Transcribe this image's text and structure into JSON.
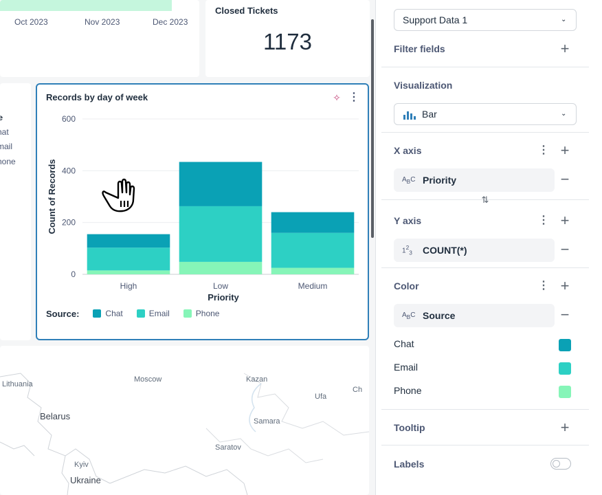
{
  "timeline": {
    "ticks": [
      "Oct 2023",
      "Nov 2023",
      "Dec 2023"
    ]
  },
  "closed": {
    "title": "Closed Tickets",
    "value": "1173"
  },
  "source_card": {
    "header": "rce",
    "items": [
      "hat",
      "mail",
      "hone"
    ]
  },
  "chart": {
    "menu_icon": "kebab-icon",
    "ai_icon": "sparkle-icon"
  },
  "chart_data": {
    "type": "bar",
    "stacked": true,
    "title": "Records by day of week",
    "xlabel": "Priority",
    "ylabel": "Count of Records",
    "categories": [
      "High",
      "Low",
      "Medium"
    ],
    "series": [
      {
        "name": "Chat",
        "values": [
          52,
          171,
          80
        ],
        "color": "#0aa1b5"
      },
      {
        "name": "Email",
        "values": [
          88,
          215,
          135
        ],
        "color": "#2dd0c4"
      },
      {
        "name": "Phone",
        "values": [
          15,
          48,
          25
        ],
        "color": "#86f5b8"
      }
    ],
    "ylim": [
      0,
      600
    ],
    "yticks": [
      0,
      200,
      400,
      600
    ],
    "legend_title": "Source:",
    "legend_position": "bottom-left",
    "grid": true
  },
  "map": {
    "labels": [
      "Lithuania",
      "Moscow",
      "Kazan",
      "Ufa",
      "Ch",
      "Belarus",
      "Samara",
      "Saratov",
      "Kyiv",
      "Ukraine"
    ]
  },
  "sidebar": {
    "dataset": "Support Data 1",
    "filter_fields": "Filter fields",
    "visualization": "Visualization",
    "viz_type": "Bar",
    "x_axis": "X axis",
    "x_field": "Priority",
    "y_axis": "Y axis",
    "y_field": "COUNT(*)",
    "color": "Color",
    "color_field": "Source",
    "colors": [
      {
        "label": "Chat",
        "hex": "#0aa1b5"
      },
      {
        "label": "Email",
        "hex": "#2dd0c4"
      },
      {
        "label": "Phone",
        "hex": "#86f5b8"
      }
    ],
    "tooltip": "Tooltip",
    "labels": "Labels",
    "labels_enabled": false
  }
}
